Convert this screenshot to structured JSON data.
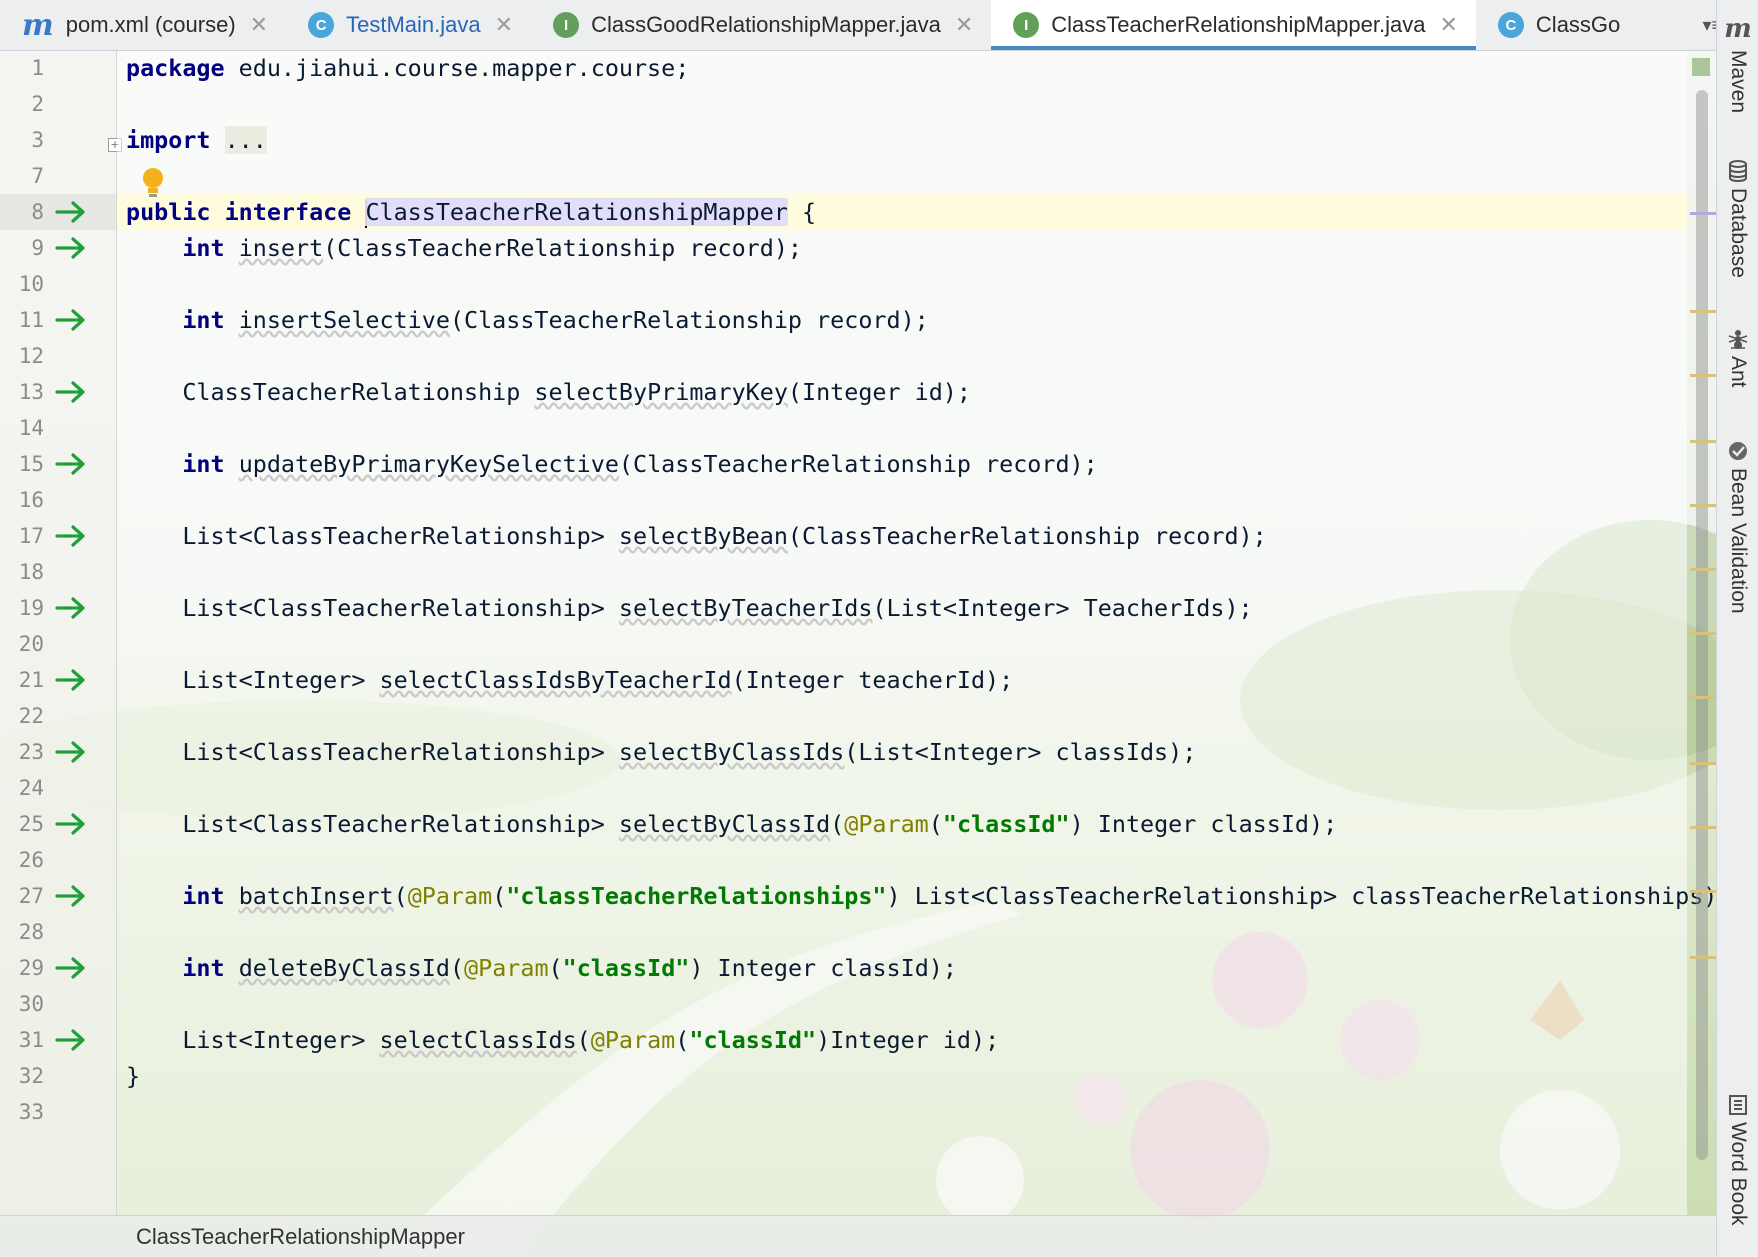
{
  "tabs": [
    {
      "label": "pom.xml (course)",
      "icon": "maven-icon",
      "active": false,
      "color": "#2b2b2b"
    },
    {
      "label": "TestMain.java",
      "icon": "class-run-icon",
      "active": false,
      "color": "#2a66b8"
    },
    {
      "label": "ClassGoodRelationshipMapper.java",
      "icon": "interface-icon",
      "active": false,
      "color": "#2b2b2b"
    },
    {
      "label": "ClassTeacherRelationshipMapper.java",
      "icon": "interface-icon",
      "active": true,
      "color": "#2b2b2b"
    },
    {
      "label": "ClassGo",
      "icon": "class-icon",
      "active": false,
      "color": "#2b2b2b"
    }
  ],
  "tab_overflow": {
    "count": "5"
  },
  "tab_icon_letters": {
    "maven": "m",
    "class": "C",
    "interface": "I"
  },
  "close_glyph": "✕",
  "line_numbers": [
    "1",
    "2",
    "3",
    "7",
    "8",
    "9",
    "10",
    "11",
    "12",
    "13",
    "14",
    "15",
    "16",
    "17",
    "18",
    "19",
    "20",
    "21",
    "22",
    "23",
    "24",
    "25",
    "26",
    "27",
    "28",
    "29",
    "30",
    "31",
    "32",
    "33"
  ],
  "code": {
    "package_kw": "package",
    "package_name": "edu.jiahui.course.mapper.course;",
    "import_kw": "import",
    "import_folded": "...",
    "decl_public": "public",
    "decl_interface": "interface",
    "interface_name": "ClassTeacherRelationshipMapper",
    "open_brace": "{",
    "close_brace": "}",
    "m_insert": {
      "kw": "int",
      "name": "insert",
      "rest": "(ClassTeacherRelationship record);"
    },
    "m_insertSelective": {
      "kw": "int",
      "name": "insertSelective",
      "rest": "(ClassTeacherRelationship record);"
    },
    "m_selectByPrimaryKey": {
      "type": "ClassTeacherRelationship",
      "name": "selectByPrimaryKey",
      "rest": "(Integer id);"
    },
    "m_updateByPrimaryKeySelective": {
      "kw": "int",
      "name": "updateByPrimaryKeySelective",
      "rest": "(ClassTeacherRelationship record);"
    },
    "m_selectByBean": {
      "type": "List<ClassTeacherRelationship>",
      "name": "selectByBean",
      "rest": "(ClassTeacherRelationship record);"
    },
    "m_selectByTeacherIds": {
      "type": "List<ClassTeacherRelationship>",
      "name": "selectByTeacherIds",
      "rest": "(List<Integer> TeacherIds);"
    },
    "m_selectClassIdsByTeacherId": {
      "type": "List<Integer>",
      "name": "selectClassIdsByTeacherId",
      "rest": "(Integer teacherId);"
    },
    "m_selectByClassIds": {
      "type": "List<ClassTeacherRelationship>",
      "name": "selectByClassIds",
      "rest": "(List<Integer> classIds);"
    },
    "m_selectByClassId": {
      "type": "List<ClassTeacherRelationship>",
      "name": "selectByClassId",
      "open": "(",
      "ann": "@Param",
      "str": "\"classId\"",
      "rest": ") Integer classId);"
    },
    "m_batchInsert": {
      "kw": "int",
      "name": "batchInsert",
      "open": "(",
      "ann": "@Param",
      "str": "\"classTeacherRelationships\"",
      "rest": ") List<ClassTeacherRelationship> classTeacherRelationships);"
    },
    "m_deleteByClassId": {
      "kw": "int",
      "name": "deleteByClassId",
      "open": "(",
      "ann": "@Param",
      "str": "\"classId\"",
      "rest": ") Integer classId);"
    },
    "m_selectClassIds": {
      "type": "List<Integer>",
      "name": "selectClassIds",
      "open": "(",
      "ann": "@Param",
      "str": "\"classId\"",
      "rest": ")Integer id);"
    }
  },
  "tool_windows": [
    {
      "label": "Maven",
      "icon": "maven-logo-icon"
    },
    {
      "label": "Database",
      "icon": "database-icon"
    },
    {
      "label": "Ant",
      "icon": "ant-icon"
    },
    {
      "label": "Bean Validation",
      "icon": "bean-validation-icon"
    },
    {
      "label": "Word Book",
      "icon": "word-book-icon"
    }
  ],
  "breadcrumb": "ClassTeacherRelationshipMapper",
  "colors": {
    "keyword": "#000080",
    "annotation": "#808000",
    "string": "#007a00",
    "implement_arrow": "#21a03a",
    "active_tab_underline": "#4a88c7",
    "identifier_highlight": "#e1dcf8"
  }
}
